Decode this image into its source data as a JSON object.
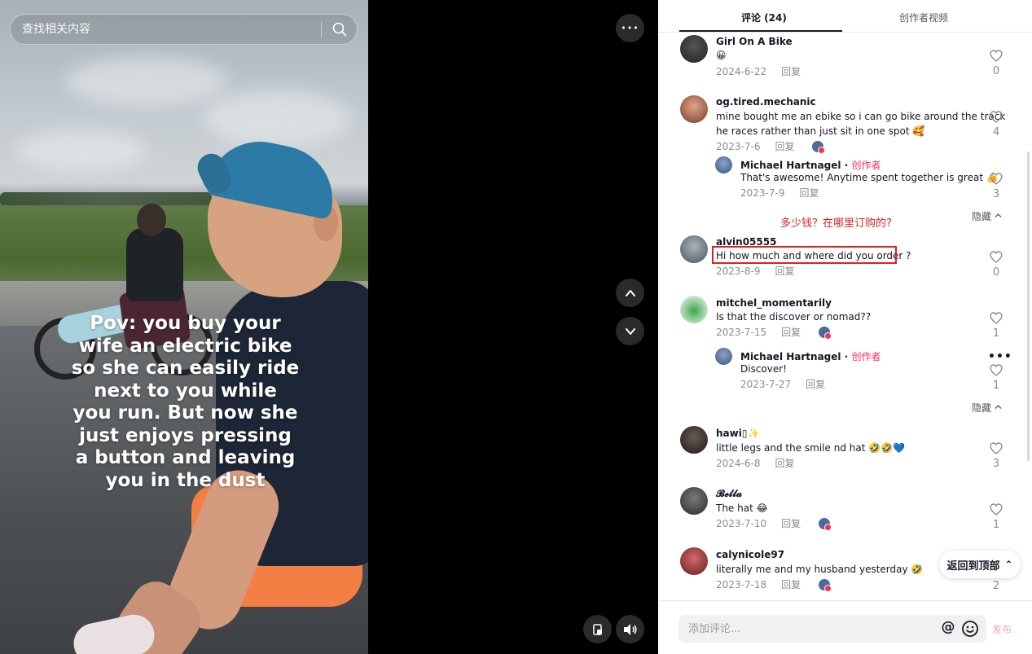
{
  "search": {
    "placeholder": "查找相关内容"
  },
  "video": {
    "caption_lines": [
      "Pov: you buy your",
      "wife an electric bike",
      "so she can easily ride",
      "next to you while",
      "you run. But now she",
      "just enjoys pressing",
      "a button and leaving",
      "you in the dust"
    ]
  },
  "controls": {
    "more_glyph": "•••",
    "up_icon": "chevron-up-icon",
    "down_icon": "chevron-down-icon",
    "pip_icon": "floating-player-icon",
    "volume_icon": "volume-icon"
  },
  "tabs": {
    "comments": "评论 (24)",
    "creator_videos": "创作者视频"
  },
  "colors": {
    "accent": "#fe2c55",
    "annotation": "#e02020",
    "text": "#161823",
    "meta": "#8a8b91"
  },
  "annotation_text": "多少钱？在哪里订购的?",
  "reply_label": "回复",
  "hide_label": "隐藏",
  "creator_label": "创作者",
  "more_glyph": "•••",
  "comments": [
    {
      "user": "Girl On A Bike",
      "text": "😀",
      "date": "2024-6-22",
      "likes": "0"
    },
    {
      "user": "og.tired.mechanic",
      "text": "mine bought me an ebike so i can go bike around the track",
      "text2": "he races rather than just sit in one spot 🥰",
      "date": "2023-7-6",
      "likes": "4"
    },
    {
      "user": "Michael Hartnagel",
      "text": "That's awesome! Anytime spent together is great 👍",
      "date": "2023-7-9",
      "likes": "3"
    },
    {
      "user": "alvin05555",
      "text": "Hi how much and where did you order ?",
      "date": "2023-8-9",
      "likes": "0"
    },
    {
      "user": "mitchel_momentarily",
      "text": "Is that the discover or nomad??",
      "date": "2023-7-15",
      "likes": "1"
    },
    {
      "user": "Michael Hartnagel",
      "text": "Discover!",
      "date": "2023-7-27",
      "likes": "1"
    },
    {
      "user": "hawi▯✨",
      "text": "little legs and the smile nd hat 🤣🤣💙",
      "date": "2024-6-8",
      "likes": "3"
    },
    {
      "user": "𝓑𝓮𝓵𝓵𝓪",
      "text": "The hat 😂",
      "date": "2023-7-10",
      "likes": "1"
    },
    {
      "user": "calynicole97",
      "text": "literally me and my husband yesterday 🤣",
      "date": "2023-7-18",
      "likes": "2"
    }
  ],
  "back_to_top": "返回到顶部",
  "back_to_top_glyph": "⌃",
  "comment_box": {
    "placeholder": "添加评论...",
    "at": "@",
    "send": "发布"
  }
}
